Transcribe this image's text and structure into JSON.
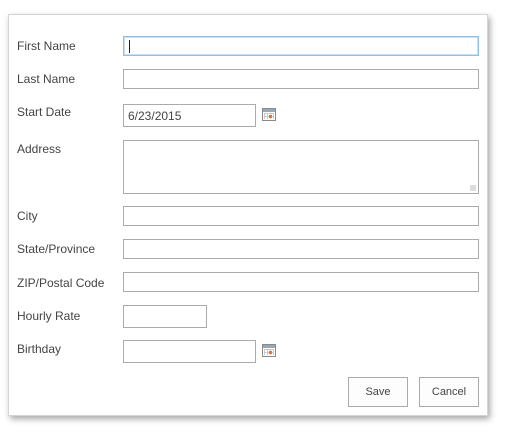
{
  "form": {
    "fields": [
      {
        "label": "First Name",
        "value": ""
      },
      {
        "label": "Last Name",
        "value": ""
      },
      {
        "label": "Start Date",
        "value": "6/23/2015"
      },
      {
        "label": "Address",
        "value": ""
      },
      {
        "label": "City",
        "value": ""
      },
      {
        "label": "State/Province",
        "value": ""
      },
      {
        "label": "ZIP/Postal Code",
        "value": ""
      },
      {
        "label": "Hourly Rate",
        "value": ""
      },
      {
        "label": "Birthday",
        "value": ""
      }
    ],
    "icons": {
      "date_picker": "calendar-icon",
      "resize": "resize-grip-icon"
    },
    "buttons": {
      "save_label": "Save",
      "cancel_label": "Cancel"
    },
    "colors": {
      "focus_border": "#92c0e0",
      "calendar_accent": "#e8742c"
    }
  }
}
